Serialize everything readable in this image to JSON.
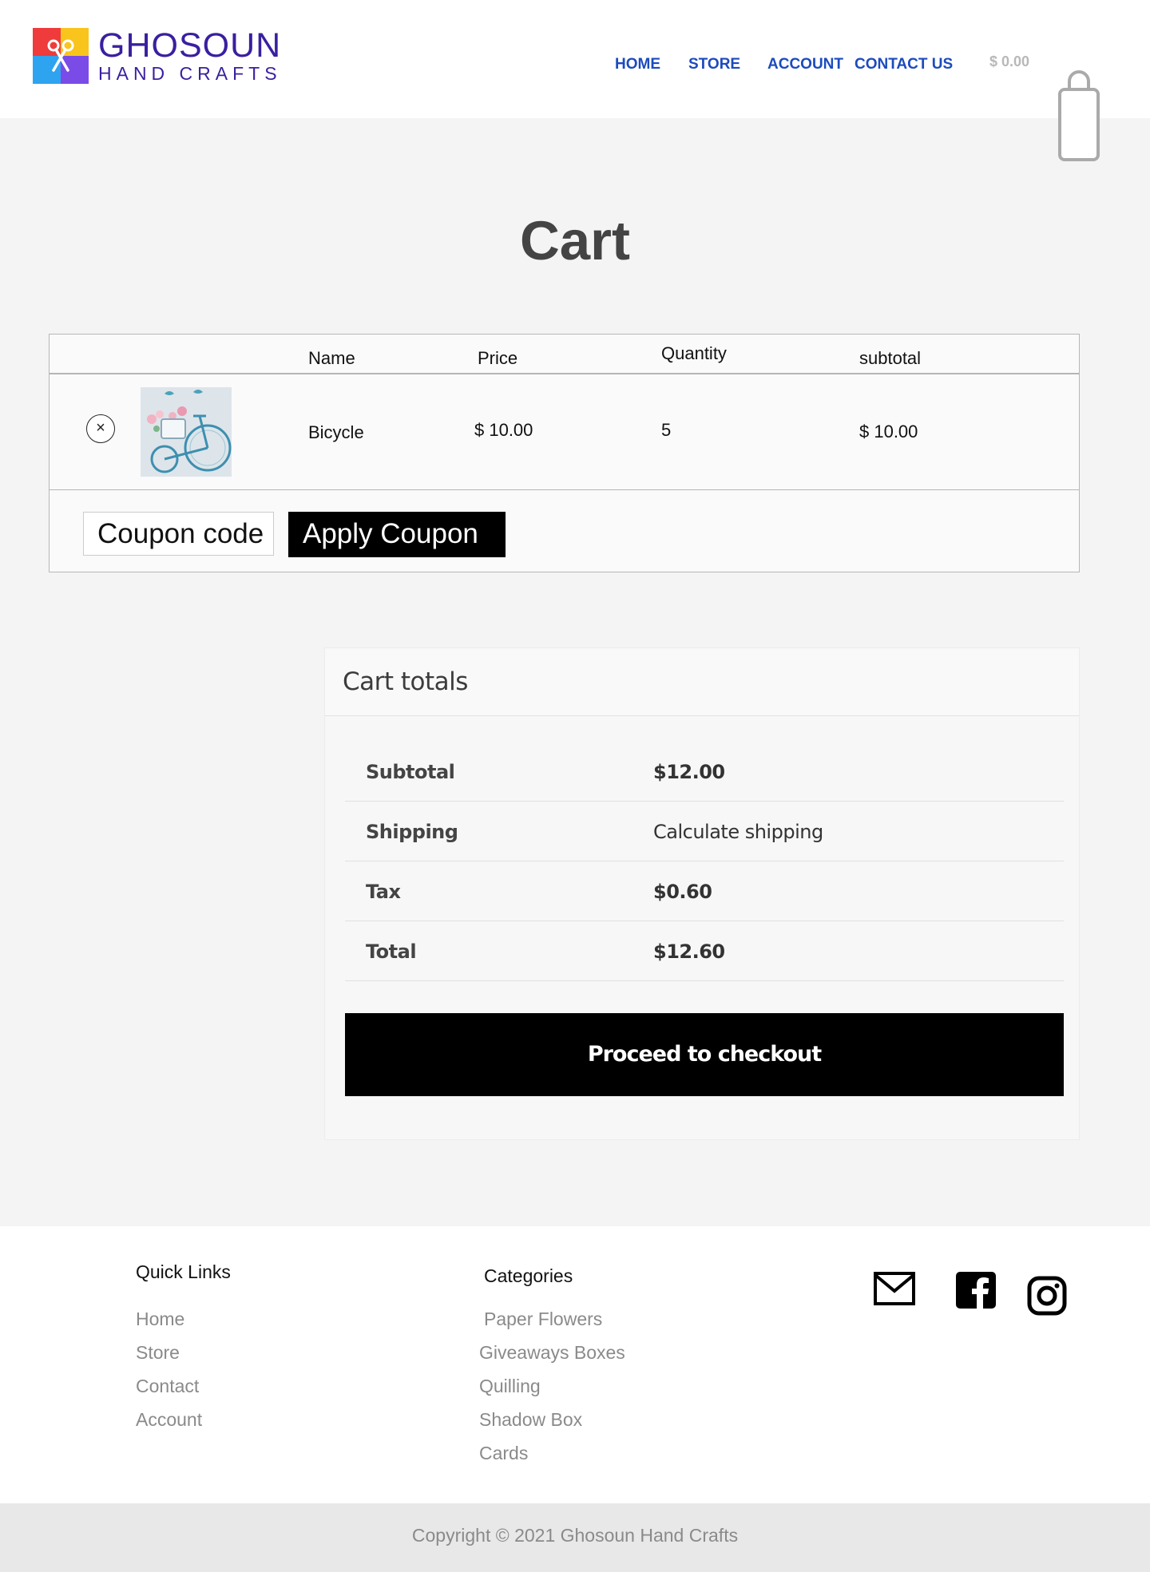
{
  "brand": {
    "line1": "GHOSOUN",
    "line2": "HAND CRAFTS"
  },
  "nav": {
    "items": [
      "HOME",
      "STORE",
      "ACCOUNT",
      "CONTACT US"
    ]
  },
  "header_cart": {
    "amount": "$ 0.00",
    "icon": "shopping-bag-icon"
  },
  "page": {
    "title": "Cart"
  },
  "cart_table": {
    "headers": {
      "name": "Name",
      "price": "Price",
      "quantity": "Quantity",
      "subtotal": "subtotal"
    },
    "items": [
      {
        "name": "Bicycle",
        "price": "$ 10.00",
        "quantity": "5",
        "subtotal": "$ 10.00"
      }
    ],
    "remove_symbol": "×",
    "coupon_placeholder": "Coupon code",
    "apply_label": "Apply Coupon"
  },
  "totals": {
    "title": "Cart totals",
    "rows": [
      {
        "label": "Subtotal",
        "value": "$12.00"
      },
      {
        "label": "Shipping",
        "value": "Calculate shipping"
      },
      {
        "label": "Tax",
        "value": "$0.60"
      },
      {
        "label": "Total",
        "value": "$12.60"
      }
    ],
    "checkout_label": "Proceed to checkout"
  },
  "footer": {
    "quick_links": {
      "heading": "Quick Links",
      "items": [
        "Home",
        "Store",
        "Contact",
        "Account"
      ]
    },
    "categories": {
      "heading": "Categories",
      "items": [
        "Paper Flowers",
        "Giveaways Boxes",
        "Quilling",
        "Shadow Box",
        "Cards"
      ]
    },
    "social": [
      "mail-icon",
      "facebook-icon",
      "instagram-icon"
    ],
    "copyright": "Copyright © 2021 Ghosoun Hand Crafts"
  },
  "colors": {
    "brand": "#3a1fa0",
    "nav": "#1c4bbd",
    "button": "#000000"
  }
}
